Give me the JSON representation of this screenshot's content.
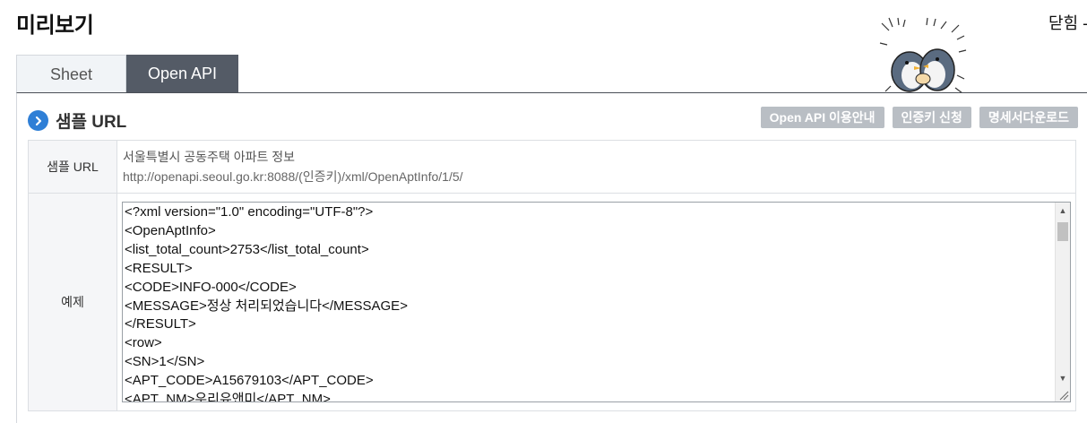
{
  "header": {
    "title": "미리보기",
    "close_label": "닫힘 -"
  },
  "tabs": [
    {
      "label": "Sheet",
      "active": false
    },
    {
      "label": "Open API",
      "active": true
    }
  ],
  "section": {
    "title": "샘플 URL",
    "buttons": [
      "Open API 이용안내",
      "인증키 신청",
      "명세서다운로드"
    ]
  },
  "sample_url": {
    "label": "샘플 URL",
    "line1": "서울특별시 공동주택 아파트 정보",
    "line2": "http://openapi.seoul.go.kr:8088/(인증키)/xml/OpenAptInfo/1/5/"
  },
  "example": {
    "label": "예제",
    "lines": [
      "<?xml version=\"1.0\" encoding=\"UTF-8\"?>",
      "<OpenAptInfo>",
      "<list_total_count>2753</list_total_count>",
      "<RESULT>",
      "<CODE>INFO-000</CODE>",
      "<MESSAGE>정상 처리되었습니다</MESSAGE>",
      "</RESULT>",
      "<row>",
      "<SN>1</SN>",
      "<APT_CODE>A15679103</APT_CODE>",
      "<APT_NM>우리유앤미</APT_NM>"
    ]
  },
  "colors": {
    "active_tab": "#545b66",
    "accent": "#2f7fd6",
    "button": "#b9bec4"
  },
  "icons": [
    "chevron-right-icon",
    "penguin-mascot",
    "scroll-up-icon",
    "scroll-down-icon",
    "resize-grip-icon"
  ]
}
